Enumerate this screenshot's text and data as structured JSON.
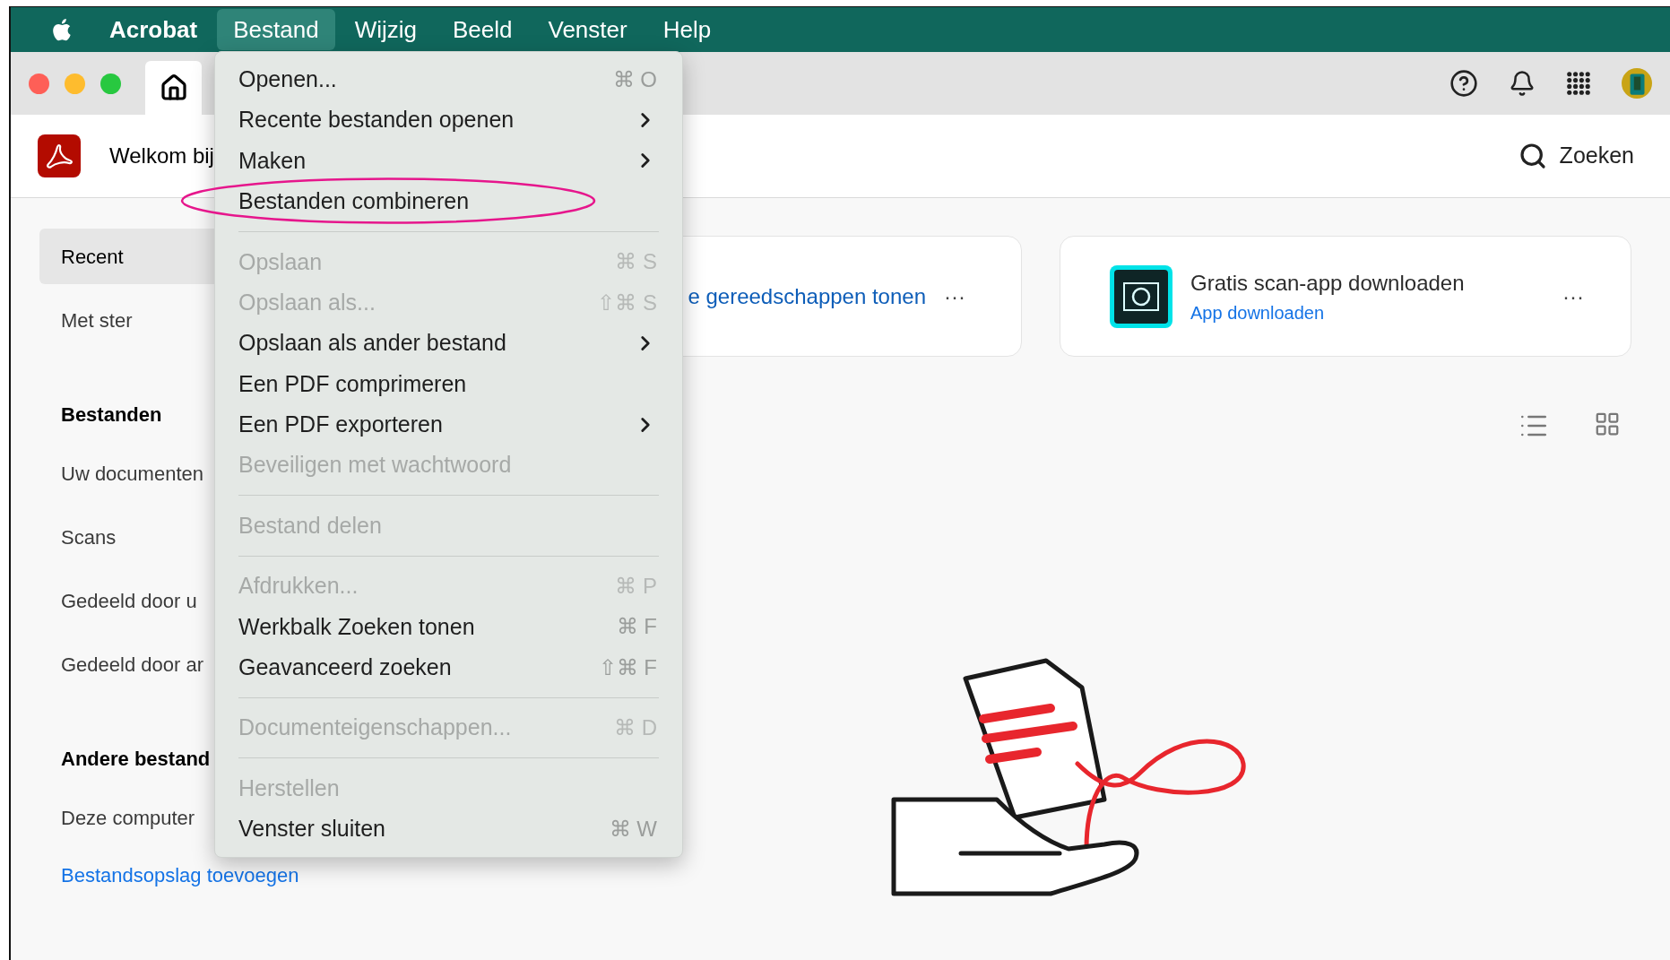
{
  "menubar": {
    "items": [
      {
        "label": "Acrobat",
        "kind": "app",
        "selected": false
      },
      {
        "label": "Bestand",
        "kind": "menu",
        "selected": true
      },
      {
        "label": "Wijzig",
        "kind": "menu",
        "selected": false
      },
      {
        "label": "Beeld",
        "kind": "menu",
        "selected": false
      },
      {
        "label": "Venster",
        "kind": "menu",
        "selected": false
      },
      {
        "label": "Help",
        "kind": "menu",
        "selected": false
      }
    ]
  },
  "header": {
    "title": "Welkom bij",
    "search": "Zoeken"
  },
  "sidebar": {
    "items": [
      {
        "label": "Recent",
        "kind": "item",
        "selected": true
      },
      {
        "label": "Met ster",
        "kind": "item",
        "selected": false
      },
      {
        "label": "Bestanden",
        "kind": "heading"
      },
      {
        "label": "Uw documenten",
        "kind": "item",
        "selected": false
      },
      {
        "label": "Scans",
        "kind": "item",
        "selected": false
      },
      {
        "label": "Gedeeld door u",
        "kind": "item",
        "selected": false
      },
      {
        "label": "Gedeeld door ar",
        "kind": "item",
        "selected": false
      },
      {
        "label": "Andere bestand",
        "kind": "heading"
      },
      {
        "label": "Deze computer",
        "kind": "item",
        "selected": false
      },
      {
        "label": "Bestandsopslag toevoegen",
        "kind": "link"
      }
    ]
  },
  "cards": [
    {
      "title": "e gereedschappen tonen",
      "more": "···"
    },
    {
      "title": "Gratis scan-app downloaden",
      "link": "App downloaden",
      "more": "···"
    }
  ],
  "file_menu": {
    "items": [
      {
        "kind": "item",
        "label": "Openen...",
        "shortcut": "⌘ O",
        "submenu": false,
        "disabled": false
      },
      {
        "kind": "item",
        "label": "Recente bestanden openen",
        "submenu": true,
        "disabled": false
      },
      {
        "kind": "item",
        "label": "Maken",
        "submenu": true,
        "disabled": false
      },
      {
        "kind": "item",
        "label": "Bestanden combineren",
        "submenu": false,
        "disabled": false,
        "circled": true
      },
      {
        "kind": "separator"
      },
      {
        "kind": "item",
        "label": "Opslaan",
        "shortcut": "⌘ S",
        "submenu": false,
        "disabled": true
      },
      {
        "kind": "item",
        "label": "Opslaan als...",
        "shortcut": "⇧⌘ S",
        "submenu": false,
        "disabled": true
      },
      {
        "kind": "item",
        "label": "Opslaan als ander bestand",
        "submenu": true,
        "disabled": false
      },
      {
        "kind": "item",
        "label": "Een PDF comprimeren",
        "submenu": false,
        "disabled": false
      },
      {
        "kind": "item",
        "label": "Een PDF exporteren",
        "submenu": true,
        "disabled": false
      },
      {
        "kind": "item",
        "label": "Beveiligen met wachtwoord",
        "submenu": false,
        "disabled": true
      },
      {
        "kind": "separator"
      },
      {
        "kind": "item",
        "label": "Bestand delen",
        "submenu": false,
        "disabled": true
      },
      {
        "kind": "separator"
      },
      {
        "kind": "item",
        "label": "Afdrukken...",
        "shortcut": "⌘ P",
        "submenu": false,
        "disabled": true
      },
      {
        "kind": "item",
        "label": "Werkbalk Zoeken tonen",
        "shortcut": "⌘ F",
        "submenu": false,
        "disabled": false
      },
      {
        "kind": "item",
        "label": "Geavanceerd zoeken",
        "shortcut": "⇧⌘ F",
        "submenu": false,
        "disabled": false
      },
      {
        "kind": "separator"
      },
      {
        "kind": "item",
        "label": "Documenteigenschappen...",
        "shortcut": "⌘ D",
        "submenu": false,
        "disabled": true
      },
      {
        "kind": "separator"
      },
      {
        "kind": "item",
        "label": "Herstellen",
        "submenu": false,
        "disabled": true
      },
      {
        "kind": "item",
        "label": "Venster sluiten",
        "shortcut": "⌘ W",
        "submenu": false,
        "disabled": false
      }
    ]
  }
}
